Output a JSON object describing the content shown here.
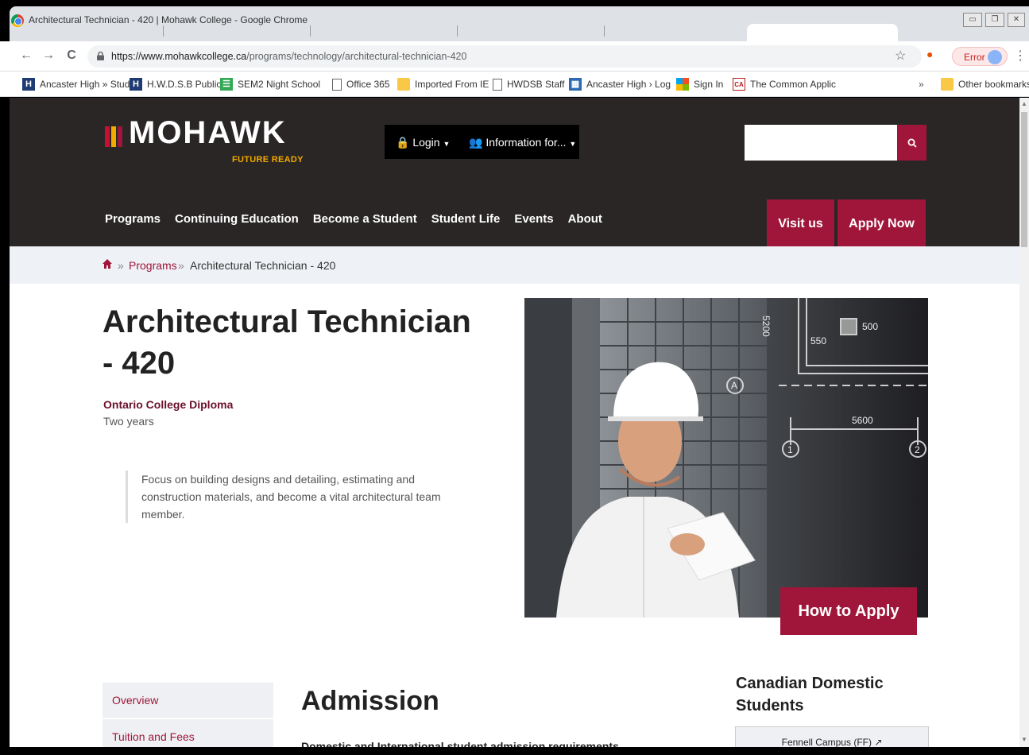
{
  "window": {
    "title": "Architectural Technician - 420 | Mohawk College - Google Chrome"
  },
  "toolbar": {
    "url_host": "https://www.mohawkcollege.ca",
    "url_path": "/programs/technology/architectural-technician-420",
    "error_label": "Error"
  },
  "bookmarks": [
    {
      "label": "Ancaster High » Stud",
      "icon": "h-icon"
    },
    {
      "label": "H.W.D.S.B Public",
      "icon": "h-icon"
    },
    {
      "label": "SEM2 Night School",
      "icon": "sheet-icon"
    },
    {
      "label": "Office 365",
      "icon": "page-icon"
    },
    {
      "label": "Imported From IE",
      "icon": "folder-icon"
    },
    {
      "label": "HWDSB Staff",
      "icon": "page-icon"
    },
    {
      "label": "Ancaster High › Log",
      "icon": "site-icon"
    },
    {
      "label": "Sign In",
      "icon": "windows-icon"
    },
    {
      "label": "The Common Applic",
      "icon": "ca-icon"
    }
  ],
  "bookmarks_overflow": "»",
  "other_bookmarks": "Other bookmarks",
  "site": {
    "logo": "MOHAWK",
    "tagline": "FUTURE READY",
    "login": "Login",
    "info_for": "Information for...",
    "nav": [
      "Programs",
      "Continuing Education",
      "Become a Student",
      "Student Life",
      "Events",
      "About"
    ],
    "visit_us": "Visit us",
    "apply_now": "Apply Now",
    "accent_color": "#a0163a",
    "header_bg": "#2a2626"
  },
  "breadcrumb": {
    "sep": "»",
    "programs": "Programs",
    "current": "Architectural Technician - 420"
  },
  "program": {
    "title": "Architectural Technician - 420",
    "credential": "Ontario College Diploma",
    "duration": "Two years",
    "lede": "Focus on building designs and detailing, estimating and construction materials, and become a vital architectural team member.",
    "how_to_apply": "How to Apply",
    "drawing_labels": [
      "5200",
      "500",
      "550",
      "5600",
      "A",
      "1",
      "2"
    ]
  },
  "side_menu": [
    "Overview",
    "Tuition and Fees"
  ],
  "admission": {
    "heading": "Admission",
    "subtext": "Domestic and International student admission requirements"
  },
  "domestic": {
    "heading": "Canadian Domestic Students",
    "campus": "Fennell Campus (FF)"
  }
}
